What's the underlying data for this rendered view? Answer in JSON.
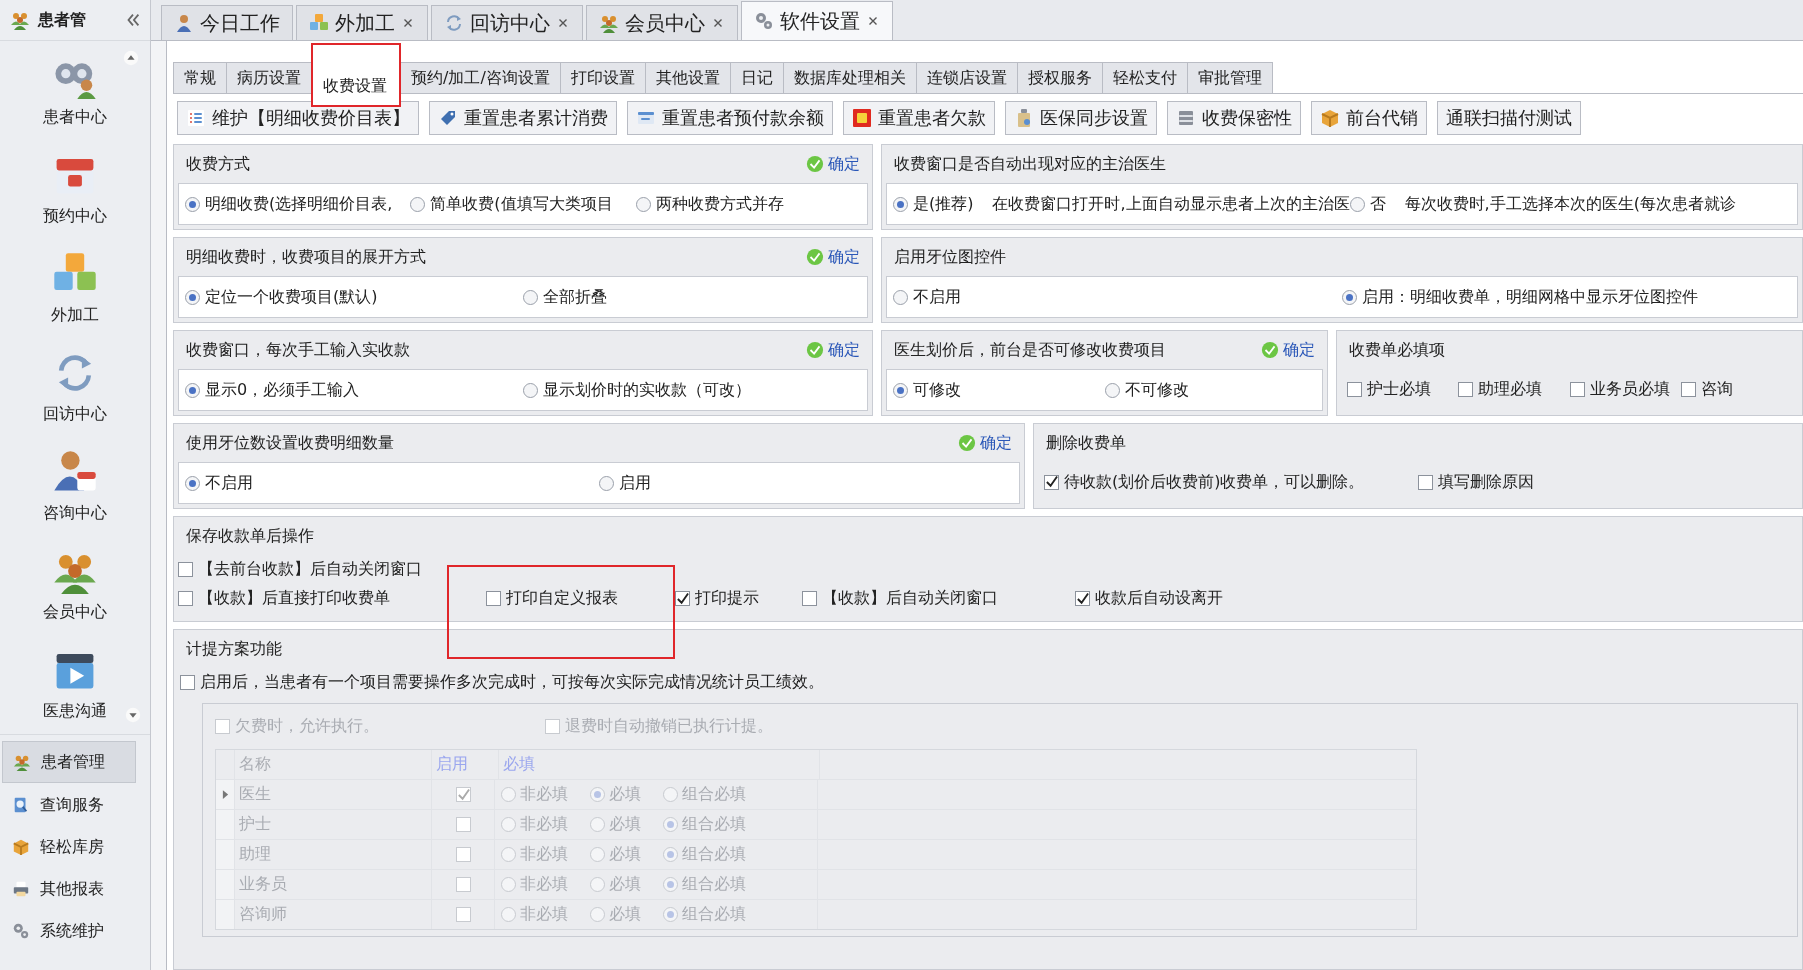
{
  "sidebar": {
    "title": "患者管",
    "big_items": [
      {
        "label": "患者中心"
      },
      {
        "label": "预约中心"
      },
      {
        "label": "外加工"
      },
      {
        "label": "回访中心"
      },
      {
        "label": "咨询中心"
      },
      {
        "label": "会员中心"
      },
      {
        "label": "医患沟通"
      }
    ],
    "nav_items": [
      {
        "label": "患者管理",
        "selected": true
      },
      {
        "label": "查询服务",
        "selected": false
      },
      {
        "label": "轻松库房",
        "selected": false
      },
      {
        "label": "其他报表",
        "selected": false
      },
      {
        "label": "系统维护",
        "selected": false
      }
    ]
  },
  "doc_tabs": [
    {
      "label": "今日工作",
      "closable": false,
      "selected": false
    },
    {
      "label": "外加工",
      "closable": true,
      "selected": false
    },
    {
      "label": "回访中心",
      "closable": true,
      "selected": false
    },
    {
      "label": "会员中心",
      "closable": true,
      "selected": false
    },
    {
      "label": "软件设置",
      "closable": true,
      "selected": true
    }
  ],
  "settings_tabs": [
    {
      "label": "常规",
      "selected": false,
      "highlighted": false
    },
    {
      "label": "病历设置",
      "selected": false,
      "highlighted": false
    },
    {
      "label": "收费设置",
      "selected": true,
      "highlighted": true
    },
    {
      "label": "预约/加工/咨询设置",
      "selected": false,
      "highlighted": false
    },
    {
      "label": "打印设置",
      "selected": false,
      "highlighted": false
    },
    {
      "label": "其他设置",
      "selected": false,
      "highlighted": false
    },
    {
      "label": "日记",
      "selected": false,
      "highlighted": false
    },
    {
      "label": "数据库处理相关",
      "selected": false,
      "highlighted": false
    },
    {
      "label": "连锁店设置",
      "selected": false,
      "highlighted": false
    },
    {
      "label": "授权服务",
      "selected": false,
      "highlighted": false
    },
    {
      "label": "轻松支付",
      "selected": false,
      "highlighted": false
    },
    {
      "label": "审批管理",
      "selected": false,
      "highlighted": false
    }
  ],
  "toolbar": [
    "维护【明细收费价目表】",
    "重置患者累计消费",
    "重置患者预付款余额",
    "重置患者欠款",
    "医保同步设置",
    "收费保密性",
    "前台代销",
    "通联扫描付测试"
  ],
  "panel_rows": [
    [
      {
        "title": "收费方式",
        "confirm": "确定",
        "kind": "radio",
        "options": [
          {
            "label": "明细收费(选择明细价目表,",
            "selected": true
          },
          {
            "label": "简单收费(值填写大类项目",
            "selected": false
          },
          {
            "label": "两种收费方式并存",
            "selected": false
          }
        ]
      },
      {
        "title": "收费窗口是否自动出现对应的主治医生",
        "kind": "radio",
        "options": [
          {
            "label": "是(推荐)",
            "note": "在收费窗口打开时,上面自动显示患者上次的主治医",
            "selected": true
          },
          {
            "label": "否",
            "note": "每次收费时,手工选择本次的医生(每次患者就诊",
            "selected": false
          }
        ]
      }
    ],
    [
      {
        "title": "明细收费时，收费项目的展开方式",
        "confirm": "确定",
        "kind": "radio",
        "options": [
          {
            "label": "定位一个收费项目(默认)",
            "selected": true
          },
          {
            "label": "全部折叠",
            "selected": false
          }
        ]
      },
      {
        "title": "启用牙位图控件",
        "kind": "radio",
        "options": [
          {
            "label": "不启用",
            "selected": false
          },
          {
            "label": "启用：明细收费单，明细网格中显示牙位图控件",
            "selected": true
          }
        ]
      }
    ],
    [
      {
        "title": "收费窗口，每次手工输入实收款",
        "confirm": "确定",
        "kind": "radio",
        "options": [
          {
            "label": "显示0，必须手工输入",
            "selected": true
          },
          {
            "label": "显示划价时的实收款（可改）",
            "selected": false
          }
        ]
      },
      {
        "title": "医生划价后，前台是否可修改收费项目",
        "confirm": "确定",
        "kind": "radio",
        "options": [
          {
            "label": "可修改",
            "selected": true
          },
          {
            "label": "不可修改",
            "selected": false
          }
        ]
      },
      {
        "title": "收费单必填项",
        "kind": "check",
        "options": [
          {
            "label": "护士必填",
            "checked": false
          },
          {
            "label": "助理必填",
            "checked": false
          },
          {
            "label": "业务员必填",
            "checked": false
          },
          {
            "label": "咨询",
            "checked": false
          }
        ]
      }
    ],
    [
      {
        "title": "使用牙位数设置收费明细数量",
        "confirm": "确定",
        "kind": "radio",
        "options": [
          {
            "label": "不启用",
            "selected": true
          },
          {
            "label": "启用",
            "selected": false
          }
        ]
      },
      {
        "title": "删除收费单",
        "kind": "check",
        "options": [
          {
            "label": "待收款(划价后收费前)收费单，可以删除。",
            "checked": true
          },
          {
            "label": "填写删除原因",
            "checked": false
          }
        ]
      }
    ]
  ],
  "save_panel": {
    "title": "保存收款单后操作",
    "annotation": {
      "kind": "highlight-box"
    },
    "lines": [
      [
        {
          "label": "【去前台收款】后自动关闭窗口",
          "checked": false
        }
      ],
      [
        {
          "label": "【收款】后直接打印收费单",
          "checked": false
        },
        {
          "label": "打印自定义报表",
          "checked": false
        },
        {
          "label": "打印提示",
          "checked": true
        },
        {
          "label": "【收款】后自动关闭窗口",
          "checked": false
        },
        {
          "label": "收款后自动设离开",
          "checked": true
        }
      ]
    ]
  },
  "commission_panel": {
    "title": "计提方案功能",
    "enable": {
      "label": "启用后，当患者有一个项目需要操作多次完成时，可按每次实际完成情况统计员工绩效。",
      "checked": false
    },
    "disabled": true,
    "options": [
      {
        "label": "欠费时，允许执行。",
        "checked": false
      },
      {
        "label": "退费时自动撤销已执行计提。",
        "checked": false
      }
    ],
    "table": {
      "columns": [
        "名称",
        "启用",
        "必填"
      ],
      "rows": [
        {
          "name": "医生",
          "enabled": true,
          "current": true,
          "choices": [
            {
              "label": "非必填",
              "selected": false
            },
            {
              "label": "必填",
              "selected": true
            },
            {
              "label": "组合必填",
              "selected": false
            }
          ]
        },
        {
          "name": "护士",
          "enabled": false,
          "current": false,
          "choices": [
            {
              "label": "非必填",
              "selected": false
            },
            {
              "label": "必填",
              "selected": false
            },
            {
              "label": "组合必填",
              "selected": true
            }
          ]
        },
        {
          "name": "助理",
          "enabled": false,
          "current": false,
          "choices": [
            {
              "label": "非必填",
              "selected": false
            },
            {
              "label": "必填",
              "selected": false
            },
            {
              "label": "组合必填",
              "selected": true
            }
          ]
        },
        {
          "name": "业务员",
          "enabled": false,
          "current": false,
          "choices": [
            {
              "label": "非必填",
              "selected": false
            },
            {
              "label": "必填",
              "selected": false
            },
            {
              "label": "组合必填",
              "selected": true
            }
          ]
        },
        {
          "name": "咨询师",
          "enabled": false,
          "current": false,
          "choices": [
            {
              "label": "非必填",
              "selected": false
            },
            {
              "label": "必填",
              "selected": false
            },
            {
              "label": "组合必填",
              "selected": true
            }
          ]
        }
      ]
    }
  }
}
